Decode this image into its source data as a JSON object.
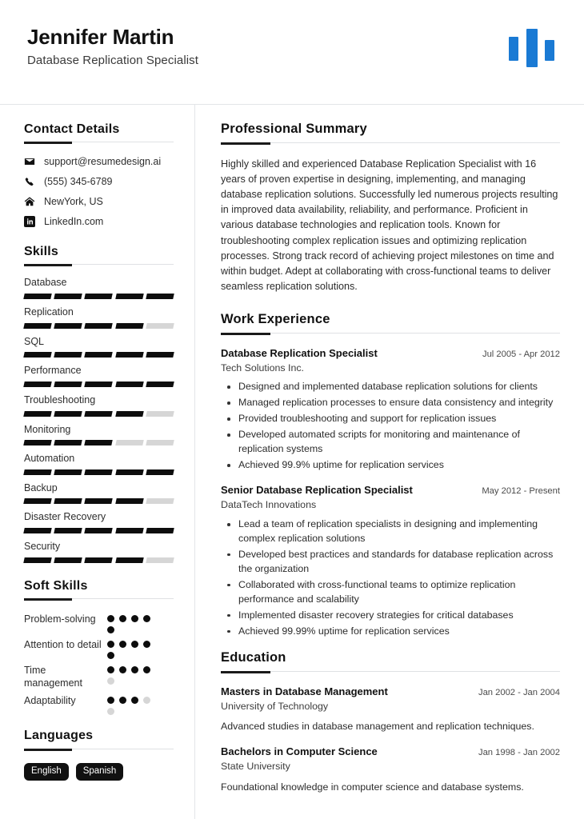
{
  "header": {
    "name": "Jennifer Martin",
    "headline": "Database Replication Specialist",
    "logo": {
      "name": "brand-logo",
      "color": "#1a7ad4",
      "bars": 3
    }
  },
  "sidebar": {
    "contact": {
      "title": "Contact Details",
      "items": [
        {
          "icon": "email-icon",
          "value": "support@resumedesign.ai"
        },
        {
          "icon": "phone-icon",
          "value": "(555) 345-6789"
        },
        {
          "icon": "home-icon",
          "value": "NewYork, US"
        },
        {
          "icon": "linkedin-icon",
          "value": "LinkedIn.com"
        }
      ]
    },
    "skills": {
      "title": "Skills",
      "max": 5,
      "items": [
        {
          "label": "Database",
          "level": 5
        },
        {
          "label": "Replication",
          "level": 4
        },
        {
          "label": "SQL",
          "level": 5
        },
        {
          "label": "Performance",
          "level": 5
        },
        {
          "label": "Troubleshooting",
          "level": 4
        },
        {
          "label": "Monitoring",
          "level": 3
        },
        {
          "label": "Automation",
          "level": 5
        },
        {
          "label": "Backup",
          "level": 4
        },
        {
          "label": "Disaster Recovery",
          "level": 5
        },
        {
          "label": "Security",
          "level": 4
        }
      ]
    },
    "soft_skills": {
      "title": "Soft Skills",
      "max": 5,
      "items": [
        {
          "label": "Problem-solving",
          "level": 5
        },
        {
          "label": "Attention to detail",
          "level": 5
        },
        {
          "label": "Time management",
          "level": 4
        },
        {
          "label": "Adaptability",
          "level": 3
        }
      ]
    },
    "languages": {
      "title": "Languages",
      "items": [
        "English",
        "Spanish"
      ]
    }
  },
  "main": {
    "summary": {
      "title": "Professional Summary",
      "text": "Highly skilled and experienced Database Replication Specialist with 16 years of proven expertise in designing, implementing, and managing database replication solutions. Successfully led numerous projects resulting in improved data availability, reliability, and performance. Proficient in various database technologies and replication tools. Known for troubleshooting complex replication issues and optimizing replication processes. Strong track record of achieving project milestones on time and within budget. Adept at collaborating with cross-functional teams to deliver seamless replication solutions."
    },
    "experience": {
      "title": "Work Experience",
      "entries": [
        {
          "title": "Database Replication Specialist",
          "org": "Tech Solutions Inc.",
          "dates": "Jul 2005 - Apr 2012",
          "bullets": [
            "Designed and implemented database replication solutions for clients",
            "Managed replication processes to ensure data consistency and integrity",
            "Provided troubleshooting and support for replication issues",
            "Developed automated scripts for monitoring and maintenance of replication systems",
            "Achieved 99.9% uptime for replication services"
          ]
        },
        {
          "title": "Senior Database Replication Specialist",
          "org": "DataTech Innovations",
          "dates": "May 2012 - Present",
          "bullets": [
            "Lead a team of replication specialists in designing and implementing complex replication solutions",
            "Developed best practices and standards for database replication across the organization",
            "Collaborated with cross-functional teams to optimize replication performance and scalability",
            "Implemented disaster recovery strategies for critical databases",
            "Achieved 99.99% uptime for replication services"
          ]
        }
      ]
    },
    "education": {
      "title": "Education",
      "entries": [
        {
          "title": "Masters in Database Management",
          "org": "University of Technology",
          "dates": "Jan 2002 - Jan 2004",
          "description": "Advanced studies in database management and replication techniques."
        },
        {
          "title": "Bachelors in Computer Science",
          "org": "State University",
          "dates": "Jan 1998 - Jan 2002",
          "description": "Foundational knowledge in computer science and database systems."
        }
      ]
    }
  }
}
